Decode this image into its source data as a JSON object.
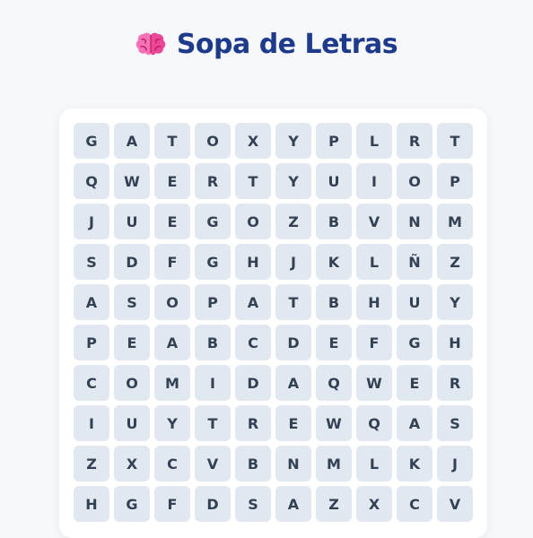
{
  "header": {
    "icon": "brain-icon",
    "title": "Sopa de Letras"
  },
  "colors": {
    "background": "#f7f8fb",
    "title": "#1e3a8a",
    "board": "#ffffff",
    "cell": "#e2e8f0",
    "letter": "#334155"
  },
  "grid": [
    [
      "G",
      "A",
      "T",
      "O",
      "X",
      "Y",
      "P",
      "L",
      "R",
      "T"
    ],
    [
      "Q",
      "W",
      "E",
      "R",
      "T",
      "Y",
      "U",
      "I",
      "O",
      "P"
    ],
    [
      "J",
      "U",
      "E",
      "G",
      "O",
      "Z",
      "B",
      "V",
      "N",
      "M"
    ],
    [
      "S",
      "D",
      "F",
      "G",
      "H",
      "J",
      "K",
      "L",
      "Ñ",
      "Z"
    ],
    [
      "A",
      "S",
      "O",
      "P",
      "A",
      "T",
      "B",
      "H",
      "U",
      "Y"
    ],
    [
      "P",
      "E",
      "A",
      "B",
      "C",
      "D",
      "E",
      "F",
      "G",
      "H"
    ],
    [
      "C",
      "O",
      "M",
      "I",
      "D",
      "A",
      "Q",
      "W",
      "E",
      "R"
    ],
    [
      "I",
      "U",
      "Y",
      "T",
      "R",
      "E",
      "W",
      "Q",
      "A",
      "S"
    ],
    [
      "Z",
      "X",
      "C",
      "V",
      "B",
      "N",
      "M",
      "L",
      "K",
      "J"
    ],
    [
      "H",
      "G",
      "F",
      "D",
      "S",
      "A",
      "Z",
      "X",
      "C",
      "V"
    ]
  ]
}
